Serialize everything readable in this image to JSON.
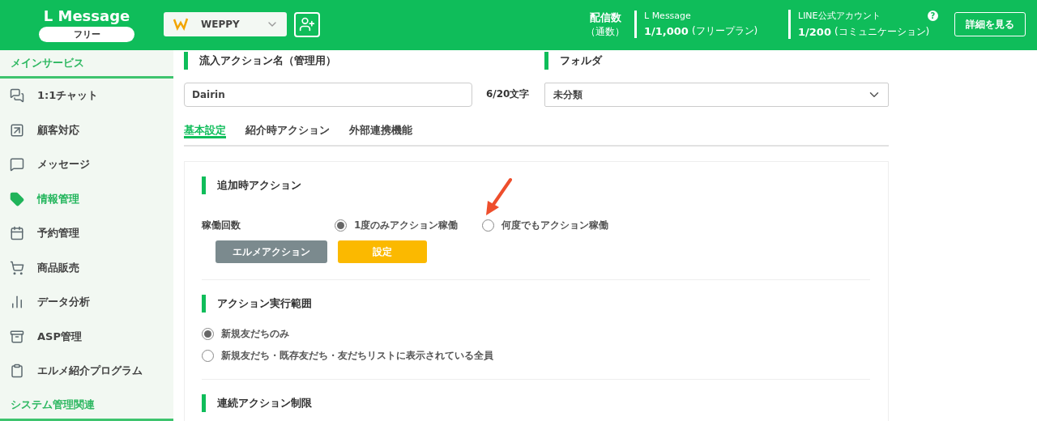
{
  "brand": {
    "title": "L Message",
    "plan": "フリー"
  },
  "account": {
    "name": "WEPPY"
  },
  "delivery": {
    "label": "配信数",
    "sub": "（通数）",
    "lmessage_label": "L Message",
    "lmessage_count": "1/1,000",
    "lmessage_plan": "(フリープラン)",
    "line_label": "LINE公式アカウント",
    "line_count": "1/200",
    "line_plan": "(コミュニケーション)",
    "help": "?",
    "details_button": "詳細を見る"
  },
  "sidebar": {
    "sections": [
      {
        "title": "メインサービス",
        "items": [
          {
            "label": "1:1チャット",
            "selected": false
          },
          {
            "label": "顧客対応",
            "selected": false
          },
          {
            "label": "メッセージ",
            "selected": false
          },
          {
            "label": "情報管理",
            "selected": true
          },
          {
            "label": "予約管理",
            "selected": false
          },
          {
            "label": "商品販売",
            "selected": false
          },
          {
            "label": "データ分析",
            "selected": false
          },
          {
            "label": "ASP管理",
            "selected": false
          },
          {
            "label": "エルメ紹介プログラム",
            "selected": false
          }
        ]
      },
      {
        "title": "システム管理関連"
      }
    ]
  },
  "form": {
    "name_heading": "流入アクション名（管理用）",
    "name_value": "Dairin",
    "name_count": "6/20文字",
    "folder_heading": "フォルダ",
    "folder_value": "未分類"
  },
  "tabs": [
    {
      "label": "基本設定",
      "selected": true
    },
    {
      "label": "紹介時アクション",
      "selected": false
    },
    {
      "label": "外部連携機能",
      "selected": false
    }
  ],
  "sections": [
    {
      "heading": "追加時アクション",
      "kind": "run_count",
      "label": "稼働回数",
      "options": [
        {
          "label": "1度のみアクション稼働",
          "selected": true
        },
        {
          "label": "何度でもアクション稼働",
          "selected": false
        }
      ],
      "buttons": [
        "エルメアクション",
        "設定"
      ]
    },
    {
      "heading": "アクション実行範囲",
      "kind": "scope",
      "options": [
        {
          "label": "新規友だちのみ",
          "selected": true
        },
        {
          "label": "新規友だち・既存友だち・友だちリストに表示されている全員",
          "selected": false
        }
      ]
    },
    {
      "heading": "連続アクション制限",
      "kind": "heading_only"
    }
  ]
}
